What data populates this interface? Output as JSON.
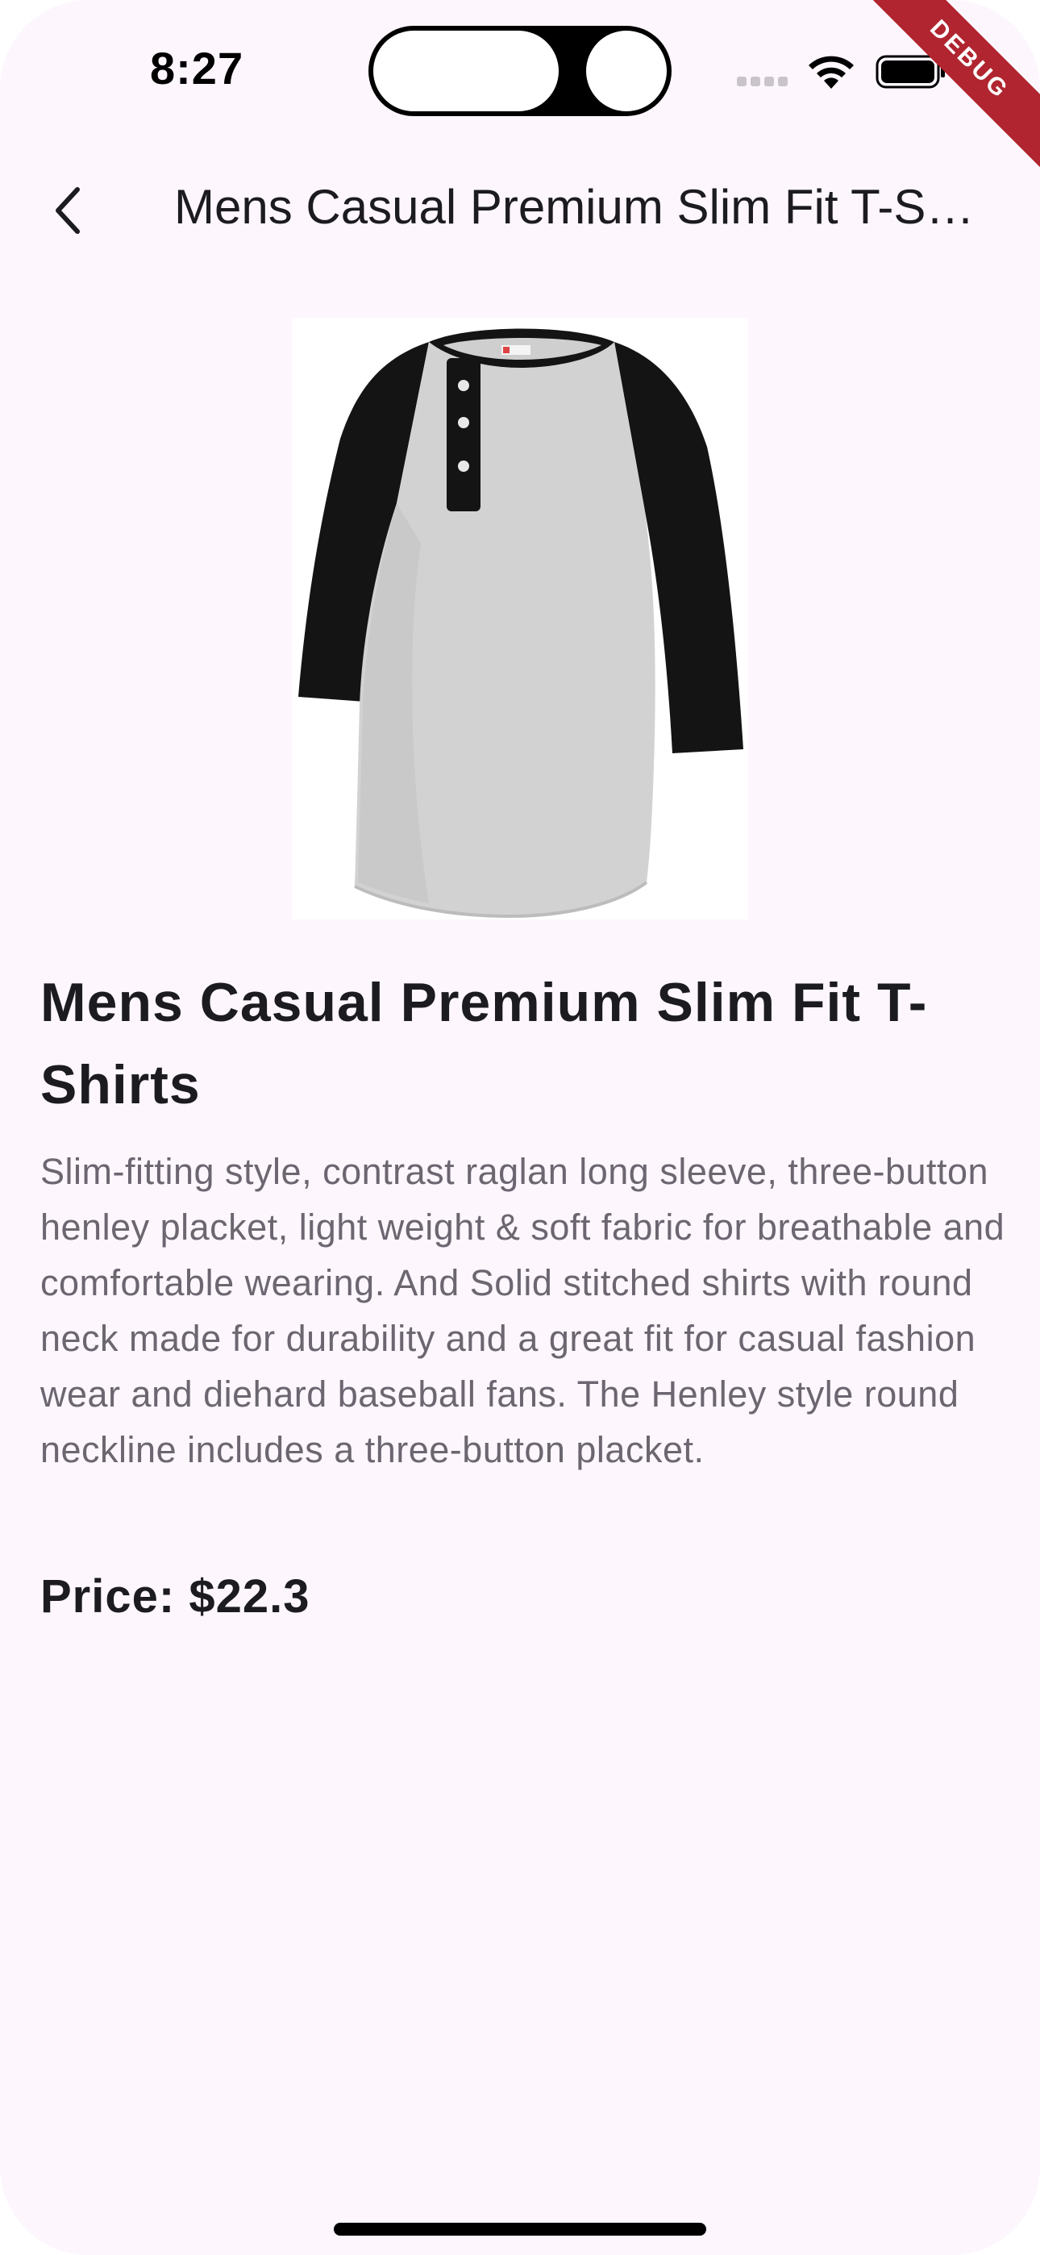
{
  "status_bar": {
    "time": "8:27",
    "debug_banner": "DEBUG",
    "icons": [
      "cellular-signal-icon",
      "wifi-icon",
      "battery-icon"
    ]
  },
  "app_bar": {
    "back_icon": "chevron-left-icon",
    "title": "Mens Casual Premium Slim Fit T-Shirts"
  },
  "product": {
    "image": "henley-raglan-shirt-image",
    "name": "Mens Casual Premium Slim Fit T-Shirts",
    "description": "Slim-fitting style, contrast raglan long sleeve, three-button henley placket, light weight & soft fabric for breathable and comfortable wearing. And Solid stitched shirts with round neck made for durability and a great fit for casual fashion wear and diehard baseball fans. The Henley style round neckline includes a three-button placket.",
    "price_label": "Price: $22.3"
  },
  "colors": {
    "background": "#fdf6fd",
    "text_primary": "#1c1b1f",
    "text_secondary": "#6b6670",
    "debug_ribbon": "#b0252f"
  }
}
